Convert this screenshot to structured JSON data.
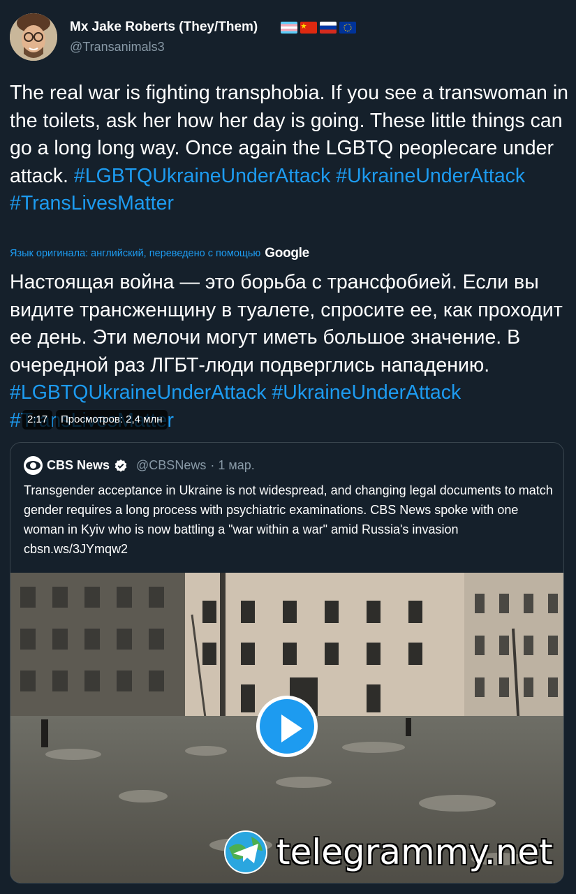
{
  "author": {
    "display_name": "Mx Jake Roberts (They/Them)",
    "handle": "@Transanimals3",
    "flags": [
      "transgender-flag",
      "china-flag",
      "russia-flag",
      "eu-flag"
    ]
  },
  "tweet": {
    "text_plain": "The real war is fighting transphobia. If you see a transwoman in the toilets, ask her how her day is going. These little things can go a long long way. Once again the LGBTQ peoplecare under attack.",
    "hashtags": [
      "#LGBTQUkraineUnderAttack",
      "#UkraineUnderAttack",
      "#TransLivesMatter"
    ],
    "translation_note": "Язык оригинала: английский, переведено с помощью",
    "translation_provider": "Google",
    "translated_plain": "Настоящая война — это борьба с трансфобией. Если вы видите трансженщину в туалете, спросите ее, как проходит ее день. Эти мелочи могут иметь большое значение. В очередной раз ЛГБТ-люди подверглись нападению."
  },
  "quote": {
    "name": "CBS News",
    "handle": "@CBSNews",
    "date": "· 1 мар.",
    "text": "Transgender acceptance in Ukraine is not widespread, and changing legal documents to match gender requires a long process with psychiatric examinations. CBS News spoke with one woman in Kyiv who is now battling a \"war within a war\" amid Russia's invasion cbsn.ws/3JYmqw2",
    "video": {
      "duration": "2:17",
      "views": "Просмотров: 2,4 млн"
    }
  },
  "watermark": "telegrammy.net",
  "colors": {
    "background": "#15202b",
    "accent": "#1d9bf0",
    "secondary_text": "#8899a6",
    "border": "#38444d"
  }
}
